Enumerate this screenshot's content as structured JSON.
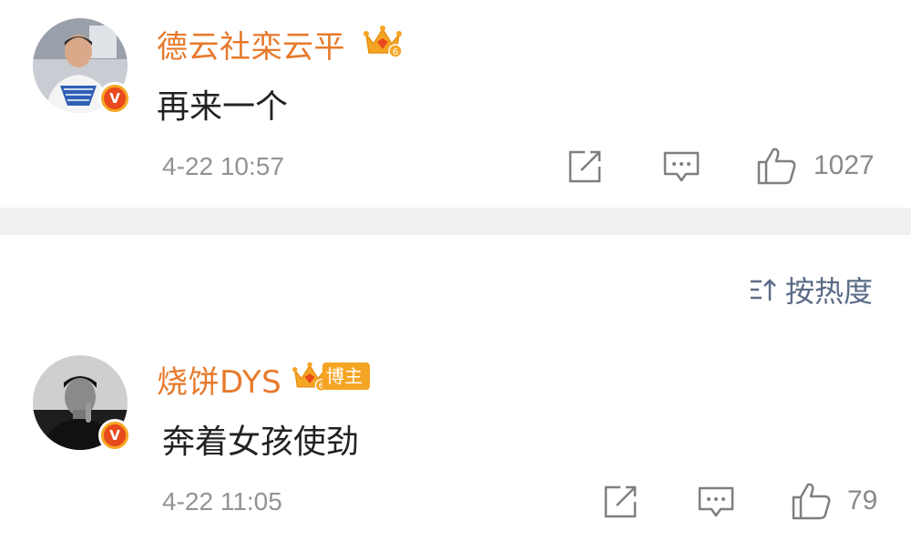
{
  "comments": [
    {
      "username": "德云社栾云平",
      "text": "再来一个",
      "timestamp": "4-22 10:57",
      "likes": "1027",
      "level": "6",
      "avatar_icon": "person-avatar",
      "badge_icon": "verified-v-icon",
      "badge_letter": "V"
    },
    {
      "username": "烧饼DYS",
      "text": "奔着女孩使劲",
      "timestamp": "4-22 11:05",
      "likes": "79",
      "level": "6",
      "tag": "博主",
      "avatar_icon": "person-avatar",
      "badge_icon": "verified-v-icon",
      "badge_letter": "V"
    }
  ],
  "sort": {
    "label": "按热度",
    "icon": "sort-icon"
  },
  "colors": {
    "username": "#e77a2c",
    "text": "#222222",
    "meta": "#939393",
    "divider": "#f0f0f0",
    "sort": "#5a6b86",
    "badge_orange": "#f6a623",
    "badge_red": "#e8491d"
  }
}
